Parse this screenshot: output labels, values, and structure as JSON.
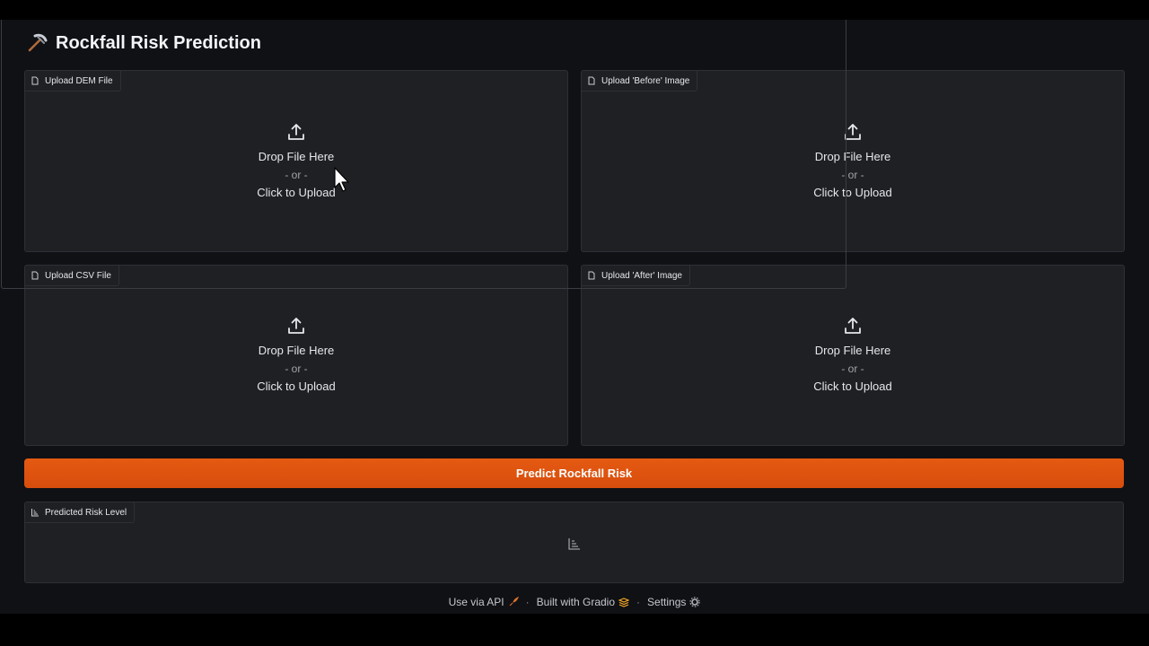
{
  "header": {
    "title": "Rockfall Risk Prediction",
    "icon": "pickaxe-icon"
  },
  "uploads": [
    {
      "label": "Upload DEM File",
      "drop": "Drop File Here",
      "or": "- or -",
      "click": "Click to Upload"
    },
    {
      "label": "Upload 'Before' Image",
      "drop": "Drop File Here",
      "or": "- or -",
      "click": "Click to Upload"
    },
    {
      "label": "Upload CSV File",
      "drop": "Drop File Here",
      "or": "- or -",
      "click": "Click to Upload"
    },
    {
      "label": "Upload 'After' Image",
      "drop": "Drop File Here",
      "or": "- or -",
      "click": "Click to Upload"
    }
  ],
  "predict_button": {
    "label": "Predict Rockfall Risk",
    "color": "#e0500f"
  },
  "output": {
    "label": "Predicted Risk Level",
    "icon": "chart-icon"
  },
  "footer": {
    "api": "Use via API",
    "built": "Built with Gradio",
    "settings": "Settings",
    "separator": "·"
  }
}
